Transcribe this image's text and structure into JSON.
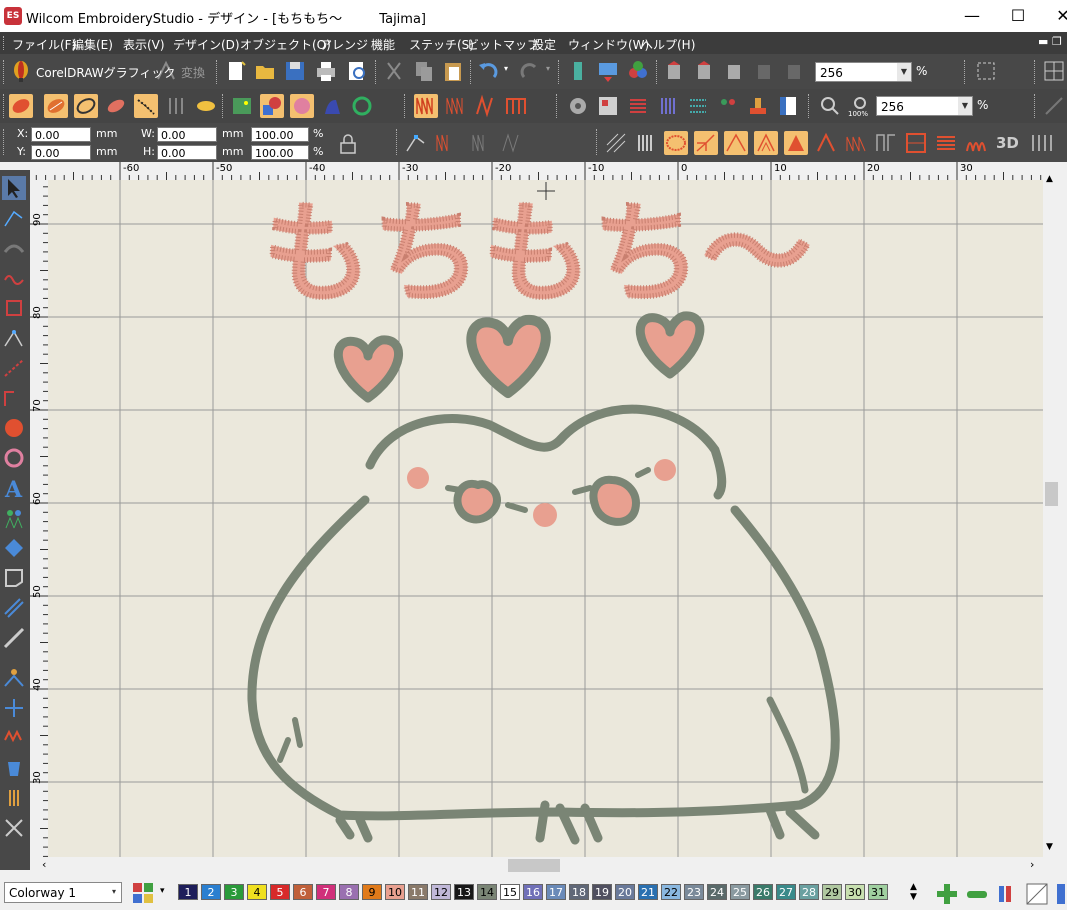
{
  "window": {
    "title": "Wilcom EmbroideryStudio - デザイン - [もちもち〜         Tajima]",
    "app_icon_text": "ES",
    "minimize": "—",
    "maximize": "☐",
    "close": "✕"
  },
  "menubar": {
    "items": [
      "ファイル(F)",
      "編集(E)",
      "表示(V)",
      "デザイン(D)",
      "オブジェクト(O)",
      "アレンジ",
      "機能",
      "ステッチ(S)",
      "ビットマップ",
      "設定",
      "ウィンドウ(W)",
      "ヘルプ(H)"
    ]
  },
  "toolbar": {
    "coreldraw_label": "CorelDRAWグラフィック",
    "convert_label": "変換",
    "zoom_top": "256",
    "zoom_top_unit": "%",
    "zoom_mid": "256",
    "zoom_mid_unit": "%",
    "zoom_100_label": "100%",
    "label_3d": "3D"
  },
  "props": {
    "x_label": "X:",
    "x_value": "0.00",
    "x_unit": "mm",
    "y_label": "Y:",
    "y_value": "0.00",
    "y_unit": "mm",
    "w_label": "W:",
    "w_value": "0.00",
    "w_unit": "mm",
    "h_label": "H:",
    "h_value": "0.00",
    "h_unit": "mm",
    "w_pct": "100.00",
    "h_pct": "100.00",
    "pct_unit": "%"
  },
  "ruler": {
    "h_labels": [
      "-60",
      "-50",
      "-40",
      "-30",
      "-20",
      "-10",
      "0",
      "10",
      "20",
      "30"
    ],
    "v_labels": [
      "90",
      "80",
      "70",
      "60",
      "50",
      "40",
      "30"
    ]
  },
  "design": {
    "text": "もちもち〜",
    "pink": "#e8a090",
    "gray": "#7a8575"
  },
  "palette": {
    "colorway": "Colorway 1",
    "swatches": [
      {
        "n": "1",
        "c": "#1e1e5a",
        "t": "#fff"
      },
      {
        "n": "2",
        "c": "#2a7fd0",
        "t": "#fff"
      },
      {
        "n": "3",
        "c": "#2a9a3a",
        "t": "#fff"
      },
      {
        "n": "4",
        "c": "#f0e020",
        "t": "#000"
      },
      {
        "n": "5",
        "c": "#d82a2a",
        "t": "#fff"
      },
      {
        "n": "6",
        "c": "#c0603a",
        "t": "#fff"
      },
      {
        "n": "7",
        "c": "#d0307a",
        "t": "#fff"
      },
      {
        "n": "8",
        "c": "#9a70b0",
        "t": "#fff"
      },
      {
        "n": "9",
        "c": "#e07a1a",
        "t": "#000"
      },
      {
        "n": "10",
        "c": "#e8a090",
        "t": "#000"
      },
      {
        "n": "11",
        "c": "#8a7a6a",
        "t": "#fff"
      },
      {
        "n": "12",
        "c": "#c0b8d8",
        "t": "#000"
      },
      {
        "n": "13",
        "c": "#181818",
        "t": "#fff"
      },
      {
        "n": "14",
        "c": "#7a8575",
        "t": "#000"
      },
      {
        "n": "15",
        "c": "#ffffff",
        "t": "#000"
      },
      {
        "n": "16",
        "c": "#7070b8",
        "t": "#fff"
      },
      {
        "n": "17",
        "c": "#6a8ab8",
        "t": "#fff"
      },
      {
        "n": "18",
        "c": "#606878",
        "t": "#fff"
      },
      {
        "n": "19",
        "c": "#505060",
        "t": "#fff"
      },
      {
        "n": "20",
        "c": "#6a7a9a",
        "t": "#fff"
      },
      {
        "n": "21",
        "c": "#2a70b0",
        "t": "#fff"
      },
      {
        "n": "22",
        "c": "#8ab8e0",
        "t": "#000"
      },
      {
        "n": "23",
        "c": "#7a8a9a",
        "t": "#fff"
      },
      {
        "n": "24",
        "c": "#5a6a6a",
        "t": "#fff"
      },
      {
        "n": "25",
        "c": "#8a9aa0",
        "t": "#fff"
      },
      {
        "n": "26",
        "c": "#3a7a6a",
        "t": "#fff"
      },
      {
        "n": "27",
        "c": "#3a8a8a",
        "t": "#fff"
      },
      {
        "n": "28",
        "c": "#6aa0a0",
        "t": "#fff"
      },
      {
        "n": "29",
        "c": "#b0c8a0",
        "t": "#000"
      },
      {
        "n": "30",
        "c": "#c8e0b0",
        "t": "#000"
      },
      {
        "n": "31",
        "c": "#a0d0a0",
        "t": "#000"
      }
    ]
  }
}
